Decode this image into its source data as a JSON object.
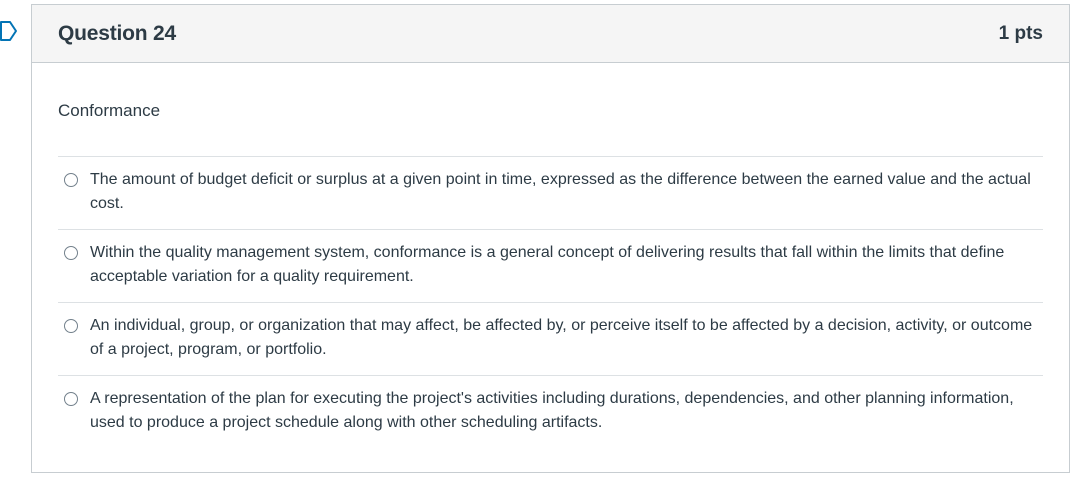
{
  "question": {
    "title": "Question 24",
    "points": "1 pts",
    "text": "Conformance",
    "answers": [
      {
        "label": "The amount of budget deficit or surplus at a given point in time, expressed as the difference between the earned value and the actual cost."
      },
      {
        "label": "Within the quality management system, conformance is a general concept of delivering results that fall within the limits that define acceptable variation for a quality requirement."
      },
      {
        "label": "An individual, group, or organization that may affect, be affected by, or perceive itself to be affected by a decision, activity, or outcome of a project, program, or portfolio."
      },
      {
        "label": "A representation of the plan for executing the project's activities including durations, dependencies, and other planning information, used to produce a project schedule along with other scheduling artifacts."
      }
    ]
  },
  "colors": {
    "header_bg": "#f5f5f5",
    "border": "#c7cdd1",
    "text": "#2d3b45",
    "flag": "#0374b5"
  },
  "icons": {
    "flag": "bookmark-flag-icon",
    "radio": "radio-button-icon"
  }
}
